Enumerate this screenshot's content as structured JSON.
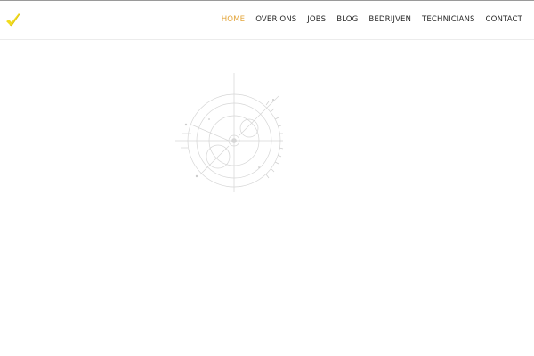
{
  "header": {
    "logo_icon": "checkmark-logo-icon",
    "brand_color": "#f2dc1f",
    "nav": [
      {
        "label": "HOME",
        "active": true
      },
      {
        "label": "OVER ONS",
        "active": false
      },
      {
        "label": "JOBS",
        "active": false
      },
      {
        "label": "BLOG",
        "active": false
      },
      {
        "label": "BEDRIJVEN",
        "active": false
      },
      {
        "label": "TECHNICIANS",
        "active": false
      },
      {
        "label": "CONTACT",
        "active": false
      }
    ],
    "active_color": "#e3a53a"
  },
  "hero": {
    "graphic_icon": "technical-gear-sketch-icon"
  }
}
